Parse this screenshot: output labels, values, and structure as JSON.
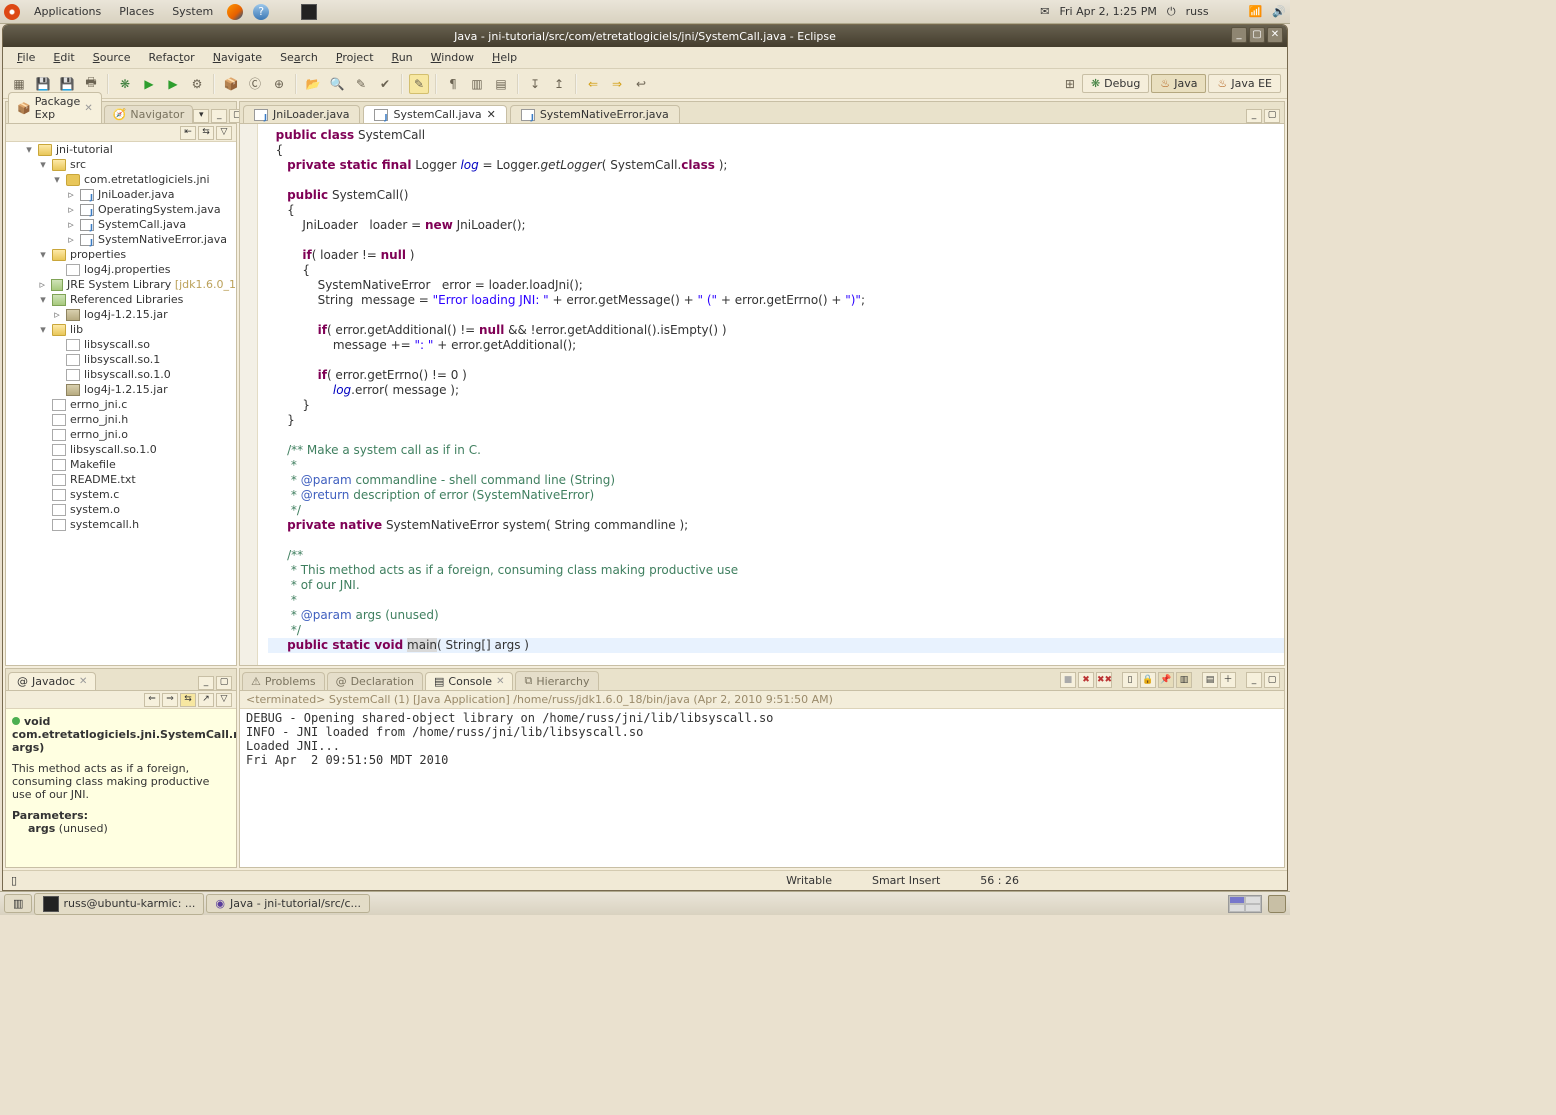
{
  "gnome": {
    "apps": "Applications",
    "places": "Places",
    "system": "System",
    "datetime": "Fri Apr  2,  1:25 PM",
    "user": "russ"
  },
  "window": {
    "title": "Java - jni-tutorial/src/com/etretatlogiciels/jni/SystemCall.java - Eclipse"
  },
  "menus": [
    "File",
    "Edit",
    "Source",
    "Refactor",
    "Navigate",
    "Search",
    "Project",
    "Run",
    "Window",
    "Help"
  ],
  "perspectives": {
    "debug": "Debug",
    "java": "Java",
    "javaee": "Java EE"
  },
  "left_top_tabs": {
    "pkg": "Package Exp",
    "nav": "Navigator"
  },
  "project_tree": {
    "project": "jni-tutorial",
    "src": "src",
    "pkg": "com.etretatlogiciels.jni",
    "java_files": [
      "JniLoader.java",
      "OperatingSystem.java",
      "SystemCall.java",
      "SystemNativeError.java"
    ],
    "properties": "properties",
    "log4j_props": "log4j.properties",
    "jre": "JRE System Library",
    "jre_ver": "[jdk1.6.0_1",
    "reflib": "Referenced Libraries",
    "log4j_jar": "log4j-1.2.15.jar",
    "lib": "lib",
    "lib_files": [
      "libsyscall.so",
      "libsyscall.so.1",
      "libsyscall.so.1.0",
      "log4j-1.2.15.jar"
    ],
    "root_files": [
      "errno_jni.c",
      "errno_jni.h",
      "errno_jni.o",
      "libsyscall.so.1.0",
      "Makefile",
      "README.txt",
      "system.c",
      "system.o",
      "systemcall.h"
    ]
  },
  "editor_tabs": [
    "JniLoader.java",
    "SystemCall.java",
    "SystemNativeError.java"
  ],
  "javadoc_tab": "Javadoc",
  "javadoc": {
    "sig1": "void",
    "sig2": "com.etretatlogiciels.jni.SystemCall.main(String[] args)",
    "desc": "This method acts as if a foreign, consuming class making productive use of our JNI.",
    "params_h": "Parameters:",
    "params": "args (unused)"
  },
  "bottom_tabs": [
    "Problems",
    "Declaration",
    "Console",
    "Hierarchy"
  ],
  "console": {
    "status": "<terminated> SystemCall (1) [Java Application] /home/russ/jdk1.6.0_18/bin/java (Apr 2, 2010 9:51:50 AM)",
    "lines": "DEBUG - Opening shared-object library on /home/russ/jni/lib/libsyscall.so\nINFO - JNI loaded from /home/russ/jni/lib/libsyscall.so\nLoaded JNI...\nFri Apr  2 09:51:50 MDT 2010"
  },
  "status": {
    "writable": "Writable",
    "insert": "Smart Insert",
    "pos": "56 : 26"
  },
  "taskbar": {
    "t1": "russ@ubuntu-karmic: ...",
    "t2": "Java - jni-tutorial/src/c..."
  }
}
